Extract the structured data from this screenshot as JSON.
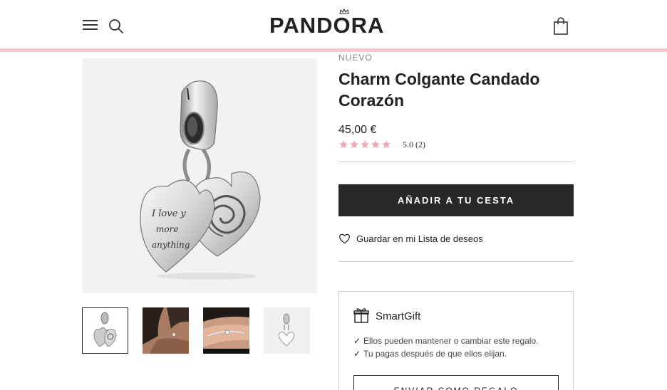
{
  "header": {
    "logo_text": "PANDORA",
    "menu_icon": "hamburger-menu-icon",
    "search_icon": "search-icon",
    "bag_icon": "shopping-bag-icon",
    "accent_strip_color": "#f7c9cf"
  },
  "product": {
    "badge": "NUEVO",
    "title": "Charm Colgante Candado Corazón",
    "price": "45,00 €",
    "rating": {
      "stars": 5,
      "max": 5,
      "label": "5.0 (2)",
      "star_color": "#f0a8b8"
    },
    "charm_engraving": [
      "I love y",
      "more",
      "anything"
    ]
  },
  "actions": {
    "add_to_cart_label": "AÑADIR A TU CESTA",
    "add_to_cart_color": "#2a2826",
    "wishlist_label": "Guardar en mi Lista de deseos"
  },
  "gallery": {
    "thumbnails": [
      {
        "name": "thumb-charm-front",
        "active": true
      },
      {
        "name": "thumb-model-neck",
        "active": false
      },
      {
        "name": "thumb-model-wrist",
        "active": false
      },
      {
        "name": "thumb-charm-back",
        "active": false
      }
    ]
  },
  "smartgift": {
    "title": "SmartGift",
    "lines": [
      "Ellos pueden mantener o cambiar este regalo.",
      "Tu pagas después de que ellos elijan."
    ],
    "check_symbol": "✓",
    "button_label": "ENVIAR COMO REGALO"
  }
}
